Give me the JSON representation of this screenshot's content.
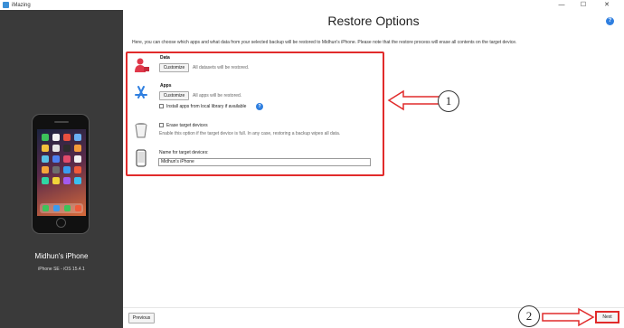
{
  "window": {
    "app_title": "iMazing",
    "minimize": "—",
    "maximize": "☐",
    "close": "✕"
  },
  "sidebar": {
    "device_name": "Midhun's iPhone",
    "device_model": "iPhone SE - iOS 15.4.1"
  },
  "header": {
    "title": "Restore Options",
    "help": "?"
  },
  "intro_text": "Here, you can choose which apps and what data from your selected backup will be restored to Midhun's iPhone. Please note that the restore process will erase all contents on the target device.",
  "options": {
    "data": {
      "label": "Data",
      "customize_label": "Customize",
      "status": "All datasets will be restored."
    },
    "apps": {
      "label": "Apps",
      "customize_label": "Customize",
      "status": "All apps will be restored.",
      "local_library_label": "Install apps from local library if available",
      "info": "?"
    },
    "erase": {
      "label": "Erase target devices",
      "description": "Enable this option if the target device is full. In any case, restoring a backup wipes all data."
    },
    "name": {
      "label": "Name for target devices:",
      "value": "Midhun's iPhone"
    }
  },
  "annotations": {
    "callout_1": "1",
    "callout_2": "2",
    "highlight_color": "#e12b2b"
  },
  "footer": {
    "previous_label": "Previous",
    "next_label": "Next"
  }
}
